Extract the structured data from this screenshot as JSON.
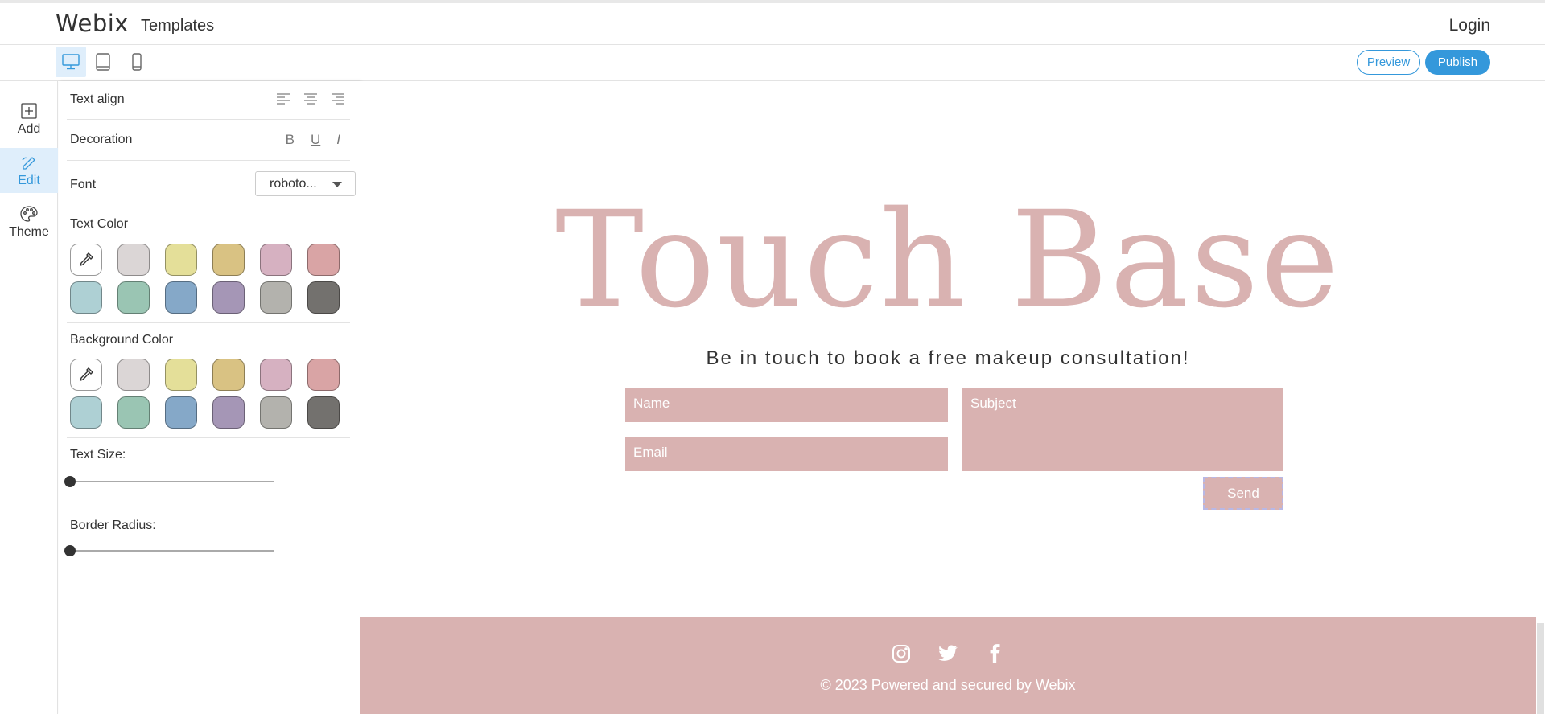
{
  "header": {
    "logo": "Webix",
    "nav_templates": "Templates",
    "login": "Login"
  },
  "toolbar": {
    "preview_label": "Preview",
    "publish_label": "Publish",
    "accent": "#3498db"
  },
  "rail": {
    "items": [
      {
        "label": "Add",
        "icon": "add-square-icon"
      },
      {
        "label": "Edit",
        "icon": "pencil-icon",
        "active": true
      },
      {
        "label": "Theme",
        "icon": "palette-icon"
      }
    ]
  },
  "panel": {
    "text_align_label": "Text align",
    "decoration_label": "Decoration",
    "decoration_bold": "B",
    "decoration_underline": "U",
    "decoration_italic": "I",
    "font_label": "Font",
    "font_value": "roboto...",
    "text_color_label": "Text Color",
    "background_color_label": "Background Color",
    "text_size_label": "Text Size:",
    "border_radius_label": "Border Radius:",
    "text_size_value": 0,
    "border_radius_value": 0,
    "swatches": [
      "#dbd6d6",
      "#e4df99",
      "#d9c283",
      "#d6b1c1",
      "#d9a4a5",
      "#aed0d4",
      "#9ac5b3",
      "#85a8c8",
      "#a596b6",
      "#b3b2ad",
      "#73716e"
    ]
  },
  "page": {
    "title": "Touch Base",
    "subtitle": "Be in touch to book a free makeup consultation!",
    "name_placeholder": "Name",
    "email_placeholder": "Email",
    "subject_placeholder": "Subject",
    "send_label": "Send",
    "copyright": "© 2023 Powered and secured by Webix",
    "accent_color": "#d9b2b1"
  }
}
